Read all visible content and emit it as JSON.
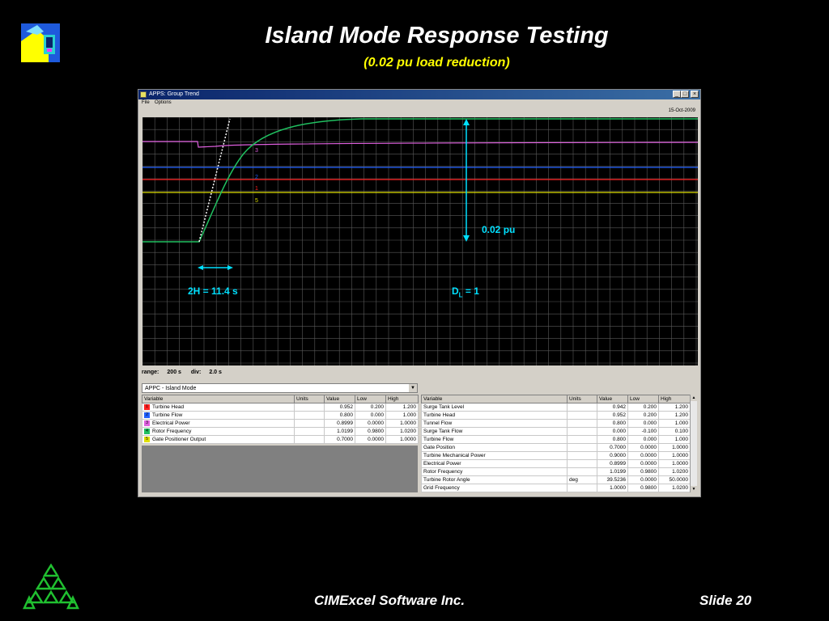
{
  "slide": {
    "title": "Island Mode Response Testing",
    "subtitle": "(0.02 pu load reduction)",
    "footer_company": "CIMExcel Software Inc.",
    "footer_slide": "Slide 20"
  },
  "window": {
    "title": "APPS: Group Trend",
    "menu": [
      "File",
      "Options"
    ],
    "date": "15-Oct-2009",
    "buttons": {
      "minimize": "_",
      "maximize": "□",
      "close": "×"
    }
  },
  "trend": {
    "range_label": "range:",
    "range_value": "200 s",
    "div_label": "div:",
    "div_value": "2.0 s",
    "annotations": {
      "delta": "0.02 pu",
      "inertia": "2H = 11.4 s",
      "damping_main": "D",
      "damping_sub": "L",
      "damping_tail": " = 1"
    },
    "trace_labels": [
      "3",
      "2",
      "1",
      "5"
    ],
    "colors": {
      "turbine_head": "#ff2020",
      "turbine_flow": "#2060ff",
      "electrical_power": "#e060e0",
      "rotor_frequency": "#20c060",
      "gate_position": "#e0e000",
      "annotation": "#00e0ff",
      "grid": "#5a5a5a"
    }
  },
  "group_select": {
    "value": "APPC - Island Mode"
  },
  "left_table": {
    "headers": [
      "Variable",
      "Units",
      "Value",
      "Low",
      "High"
    ],
    "rows": [
      {
        "n": "1",
        "color": "#ff2020",
        "variable": "Turbine Head",
        "units": "",
        "value": "0.952",
        "low": "0.200",
        "high": "1.200"
      },
      {
        "n": "2",
        "color": "#2060ff",
        "variable": "Turbine Flow",
        "units": "",
        "value": "0.800",
        "low": "0.000",
        "high": "1.000"
      },
      {
        "n": "3",
        "color": "#e060e0",
        "variable": "Electrical Power",
        "units": "",
        "value": "0.8999",
        "low": "0.0000",
        "high": "1.0000"
      },
      {
        "n": "4",
        "color": "#20c060",
        "variable": "Rotor Frequency",
        "units": "",
        "value": "1.0199",
        "low": "0.9800",
        "high": "1.0200"
      },
      {
        "n": "5",
        "color": "#e0e000",
        "variable": "Gate Positioner Output",
        "units": "",
        "value": "0.7000",
        "low": "0.0000",
        "high": "1.0000"
      }
    ]
  },
  "right_table": {
    "headers": [
      "Variable",
      "Units",
      "Value",
      "Low",
      "High"
    ],
    "rows": [
      {
        "variable": "Surge Tank Level",
        "units": "",
        "value": "0.942",
        "low": "0.200",
        "high": "1.200"
      },
      {
        "variable": "Turbine Head",
        "units": "",
        "value": "0.952",
        "low": "0.200",
        "high": "1.200"
      },
      {
        "variable": "Tunnel Flow",
        "units": "",
        "value": "0.800",
        "low": "0.000",
        "high": "1.000"
      },
      {
        "variable": "Surge Tank Flow",
        "units": "",
        "value": "0.000",
        "low": "-0.100",
        "high": "0.100"
      },
      {
        "variable": "Turbine Flow",
        "units": "",
        "value": "0.800",
        "low": "0.000",
        "high": "1.000"
      },
      {
        "variable": "Gate Position",
        "units": "",
        "value": "0.7000",
        "low": "0.0000",
        "high": "1.0000"
      },
      {
        "variable": "Turbine Mechanical Power",
        "units": "",
        "value": "0.9000",
        "low": "0.0000",
        "high": "1.0000"
      },
      {
        "variable": "Electrical Power",
        "units": "",
        "value": "0.8999",
        "low": "0.0000",
        "high": "1.0000"
      },
      {
        "variable": "Rotor Frequency",
        "units": "",
        "value": "1.0199",
        "low": "0.9800",
        "high": "1.0200"
      },
      {
        "variable": "Turbine Rotor Angle",
        "units": "deg",
        "value": "39.5236",
        "low": "0.0000",
        "high": "50.0000"
      },
      {
        "variable": "Grid Frequency",
        "units": "",
        "value": "1.0000",
        "low": "0.9800",
        "high": "1.0200"
      }
    ]
  }
}
